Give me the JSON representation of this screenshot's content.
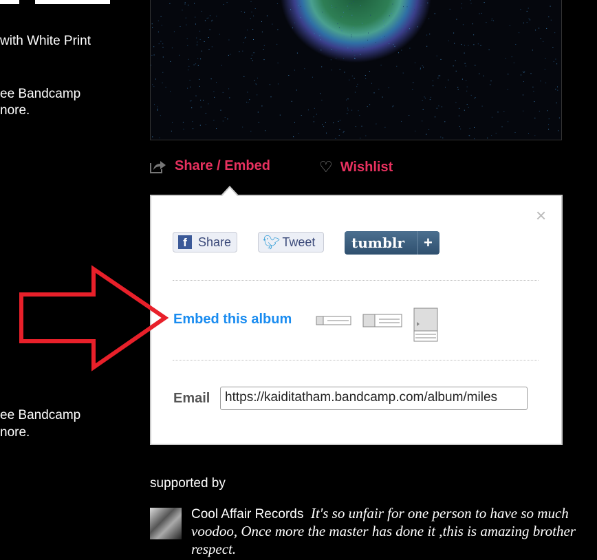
{
  "left_column": {
    "line1": "with White Print",
    "block1": [
      "ee Bandcamp",
      "nore."
    ],
    "block2": [
      "ee Bandcamp",
      "nore."
    ]
  },
  "actions": {
    "share_embed": "Share / Embed",
    "wishlist": "Wishlist",
    "link_color": "#e8315f"
  },
  "share_panel": {
    "facebook": "Share",
    "twitter": "Tweet",
    "tumblr": "tumblr",
    "tumblr_plus": "+",
    "embed_label": "Embed this album",
    "email_label": "Email",
    "email_value": "https://kaiditatham.bandcamp.com/album/miles",
    "close": "×"
  },
  "supported_by": {
    "heading": "supported by",
    "items": [
      {
        "name": "Cool Affair Records",
        "quote": "It's so unfair for one person to have so much voodoo, Once more the master has done it ,this is amazing brother respect."
      }
    ]
  },
  "annotation": {
    "arrow_color": "#e8202a"
  }
}
